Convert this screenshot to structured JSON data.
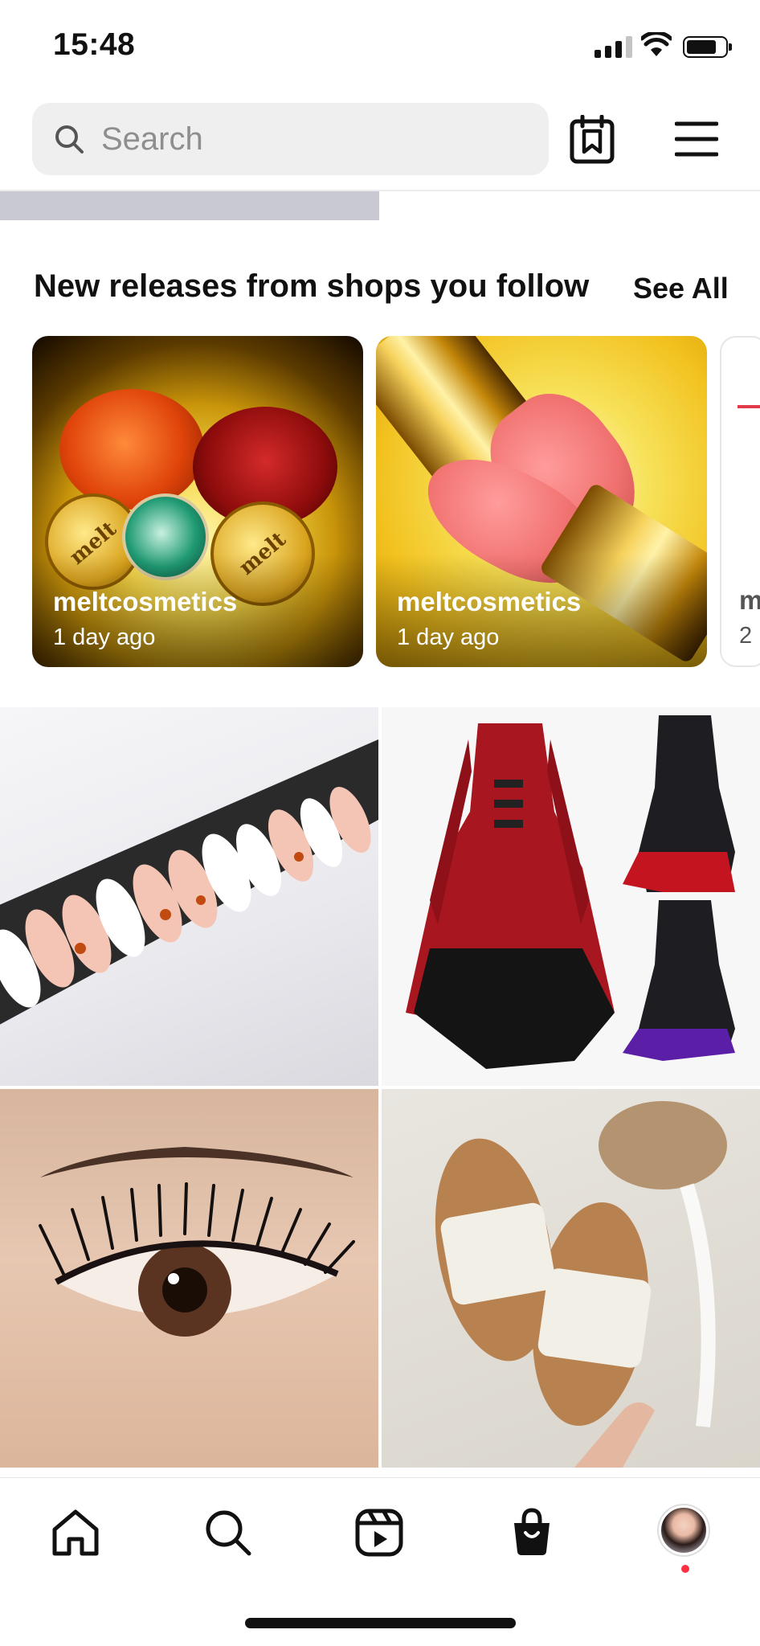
{
  "status_bar": {
    "time": "15:48",
    "icons": [
      "cellular-signal-icon",
      "wifi-icon",
      "battery-icon"
    ]
  },
  "header": {
    "search": {
      "placeholder": "Search",
      "icon": "search-icon"
    },
    "saved_icon": "saved-collections-icon",
    "menu_icon": "hamburger-menu-icon"
  },
  "new_releases": {
    "title": "New releases from shops you follow",
    "see_all_label": "See All",
    "cards": [
      {
        "shop": "meltcosmetics",
        "time": "1 day ago",
        "product_text": "melt"
      },
      {
        "shop": "meltcosmetics",
        "time": "1 day ago"
      },
      {
        "shop": "m",
        "time": "2"
      }
    ]
  },
  "grid": {
    "tiles": [
      {
        "subject": "press-on nails with butterflies"
      },
      {
        "subject": "red and black gothic coats"
      },
      {
        "subject": "false eyelashes close-up"
      },
      {
        "subject": "white woven slide sandals"
      }
    ]
  },
  "bottom_nav": {
    "items": [
      "home-icon",
      "search-icon",
      "reels-icon",
      "shop-bag-icon",
      "profile-avatar"
    ],
    "active": "shop-bag-icon",
    "colors": {
      "notification_dot": "#ff3040"
    }
  }
}
